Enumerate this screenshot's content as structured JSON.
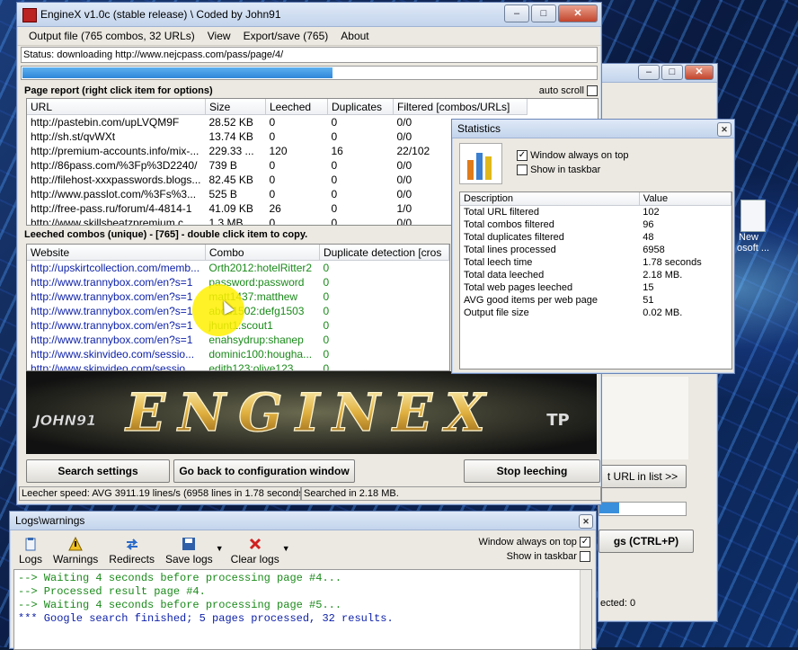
{
  "main_window": {
    "title": "EngineX v1.0c  (stable release)  \\  Coded by John91",
    "menu": [
      "Output file (765 combos, 32 URLs)",
      "View",
      "Export/save (765)",
      "About"
    ],
    "status": "Status: downloading http://www.nejcpass.com/pass/page/4/",
    "progress": 0.98,
    "page_report_label": "Page report  (right click item for options)",
    "auto_scroll_label": "auto scroll",
    "page_report_columns": [
      "URL",
      "Size",
      "Leeched",
      "Duplicates",
      "Filtered  [combos/URLs]"
    ],
    "page_report_rows": [
      [
        "http://pastebin.com/upLVQM9F",
        "28.52 KB",
        "0",
        "0",
        "0/0"
      ],
      [
        "http://sh.st/qvWXt",
        "13.74 KB",
        "0",
        "0",
        "0/0"
      ],
      [
        "http://premium-accounts.info/mix-...",
        "229.33 ...",
        "120",
        "16",
        "22/102"
      ],
      [
        "http://86pass.com/%3Fp%3D2240/",
        "739 B",
        "0",
        "0",
        "0/0"
      ],
      [
        "http://filehost-xxxpasswords.blogs...",
        "82.45 KB",
        "0",
        "0",
        "0/0"
      ],
      [
        "http://www.passlot.com/%3Fs%3...",
        "525 B",
        "0",
        "0",
        "0/0"
      ],
      [
        "http://free-pass.ru/forum/4-4814-1",
        "41.09 KB",
        "26",
        "0",
        "1/0"
      ],
      [
        "http://www.skillsbeatzpremium.c...",
        "1.3 MB",
        "0",
        "0",
        "0/0"
      ]
    ],
    "leeched_label": "Leeched combos (unique) - [765] - double click item to copy.",
    "leeched_columns": [
      "Website",
      "Combo",
      "Duplicate detection [cros"
    ],
    "leeched_rows": [
      [
        "http://upskirtcollection.com/memb...",
        "Orth2012:hotelRitter2",
        "0"
      ],
      [
        "http://www.trannybox.com/en?s=1",
        "password:password",
        "0"
      ],
      [
        "http://www.trannybox.com/en?s=1",
        "matt1437:matthew",
        "0"
      ],
      [
        "http://www.trannybox.com/en?s=1",
        "abcd1502:defg1503",
        "0"
      ],
      [
        "http://www.trannybox.com/en?s=1",
        "jhunt1:scout1",
        "0"
      ],
      [
        "http://www.trannybox.com/en?s=1",
        "enahsydrup:shanep",
        "0"
      ],
      [
        "http://www.skinvideo.com/sessio...",
        "dominic100:hougha...",
        "0"
      ],
      [
        "http://www.skinvideo.com/sessio...",
        "edith123:olive123",
        "0"
      ]
    ],
    "logo_text": "ENGINEX",
    "logo_author": "JOHN91",
    "logo_tag": "TP",
    "buttons": {
      "search_settings": "Search settings",
      "go_back": "Go back to configuration window",
      "stop_leeching": "Stop leeching"
    },
    "status_speed": "Leecher speed: AVG 3911.19 lines/s (6958 lines in 1.78 seconds",
    "status_searched": "Searched in 2.18 MB."
  },
  "stats_window": {
    "title": "Statistics",
    "always_on_top_label": "Window always on top",
    "always_on_top": true,
    "show_taskbar_label": "Show in taskbar",
    "show_taskbar": false,
    "columns": [
      "Description",
      "Value"
    ],
    "rows": [
      [
        "Total URL filtered",
        "102"
      ],
      [
        "Total combos filtered",
        "96"
      ],
      [
        "Total duplicates filtered",
        "48"
      ],
      [
        "Total lines processed",
        "6958"
      ],
      [
        "Total leech time",
        "1.78 seconds"
      ],
      [
        "Total data leeched",
        "2.18 MB."
      ],
      [
        "Total web pages leeched",
        "15"
      ],
      [
        "AVG good items per web page",
        "51"
      ],
      [
        "Output file size",
        "0.02 MB."
      ]
    ]
  },
  "logs_window": {
    "title": "Logs\\warnings",
    "tools": [
      "Logs",
      "Warnings",
      "Redirects",
      "Save logs",
      "Clear logs"
    ],
    "always_on_top_label": "Window always on top",
    "show_taskbar_label": "Show in taskbar",
    "lines": [
      "--> Waiting 4 seconds before processing page #4...",
      "--> Processed result page #4.",
      "--> Waiting 4 seconds before processing page #5...",
      "*** Google search finished; 5 pages processed, 32 results."
    ]
  },
  "background_window": {
    "next_url_button": "t URL in list >>",
    "shortcut_button": "gs (CTRL+P)",
    "status_text": "ected: 0"
  },
  "desktop": {
    "icon_label_1": "New",
    "icon_label_2": "osoft ..."
  }
}
